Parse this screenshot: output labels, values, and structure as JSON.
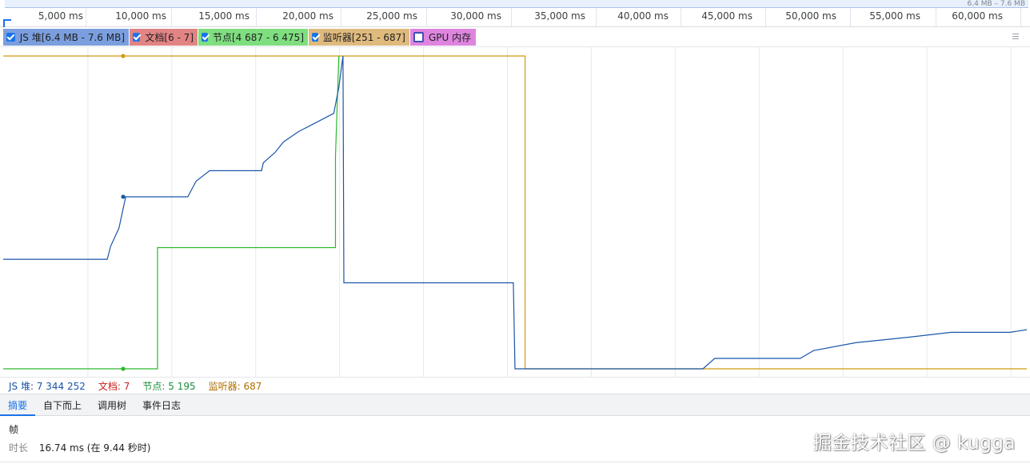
{
  "ruler": {
    "overview_label": "6.4 MB – 7.6 MB",
    "ticks": [
      "5,000 ms",
      "10,000 ms",
      "15,000 ms",
      "20,000 ms",
      "25,000 ms",
      "30,000 ms",
      "35,000 ms",
      "40,000 ms",
      "45,000 ms",
      "50,000 ms",
      "55,000 ms",
      "60,000 ms"
    ]
  },
  "legend": {
    "items": [
      {
        "label": "JS 堆[6.4 MB - 7.6 MB]",
        "checked": true,
        "bg": "#7b9fde"
      },
      {
        "label": "文档[6 - 7]",
        "checked": true,
        "bg": "#e28484"
      },
      {
        "label": "节点[4 687 - 6 475]",
        "checked": true,
        "bg": "#7fde7f"
      },
      {
        "label": "监听器[251 - 687]",
        "checked": true,
        "bg": "#dfba7d"
      },
      {
        "label": "GPU 内存",
        "checked": false,
        "bg": "#df85df"
      }
    ]
  },
  "chart_data": {
    "type": "line",
    "x_unit": "ms",
    "xlim": [
      0,
      61000
    ],
    "series": [
      {
        "name": "JS 堆",
        "color": "#1a56a8",
        "range": [
          6.4,
          7.6
        ],
        "unit": "MB",
        "points": [
          [
            0,
            6.82
          ],
          [
            6200,
            6.82
          ],
          [
            6400,
            6.87
          ],
          [
            6900,
            6.94
          ],
          [
            7100,
            7.0
          ],
          [
            7300,
            7.06
          ],
          [
            11000,
            7.06
          ],
          [
            11500,
            7.12
          ],
          [
            12300,
            7.16
          ],
          [
            15400,
            7.16
          ],
          [
            15500,
            7.19
          ],
          [
            16200,
            7.23
          ],
          [
            16700,
            7.27
          ],
          [
            17600,
            7.31
          ],
          [
            19700,
            7.38
          ],
          [
            20000,
            7.48
          ],
          [
            20250,
            7.6
          ],
          [
            20300,
            6.73
          ],
          [
            30400,
            6.73
          ],
          [
            30500,
            6.4
          ],
          [
            41700,
            6.4
          ],
          [
            42400,
            6.44
          ],
          [
            47500,
            6.44
          ],
          [
            48300,
            6.47
          ],
          [
            50800,
            6.5
          ],
          [
            53800,
            6.52
          ],
          [
            56500,
            6.54
          ],
          [
            60000,
            6.54
          ],
          [
            61000,
            6.55
          ]
        ]
      },
      {
        "name": "文档",
        "color": "#d93025",
        "range": [
          6,
          7
        ],
        "unit": "",
        "points": [
          [
            0,
            7
          ],
          [
            61000,
            7
          ]
        ]
      },
      {
        "name": "节点",
        "color": "#2db82d",
        "range": [
          4687,
          6475
        ],
        "unit": "",
        "points": [
          [
            0,
            4687
          ],
          [
            9200,
            4687
          ],
          [
            9200,
            5380
          ],
          [
            19800,
            5380
          ],
          [
            19800,
            5900
          ],
          [
            20000,
            6475
          ]
        ]
      },
      {
        "name": "监听器",
        "color": "#d19a12",
        "range": [
          251,
          687
        ],
        "unit": "",
        "points": [
          [
            0,
            687
          ],
          [
            31100,
            687
          ],
          [
            31100,
            251
          ],
          [
            61000,
            251
          ]
        ]
      }
    ],
    "markers": [
      {
        "series": "JS 堆",
        "x": 7150,
        "y": 7.06
      },
      {
        "series": "节点",
        "x": 7150,
        "y": 4687
      },
      {
        "series": "监听器",
        "x": 7150,
        "y": 687
      }
    ],
    "grid": true
  },
  "counters": {
    "js_heap": "JS 堆: 7 344 252",
    "documents": "文档: 7",
    "nodes": "节点: 5 195",
    "listeners": "监听器: 687"
  },
  "tabs": [
    {
      "label": "摘要",
      "active": true
    },
    {
      "label": "自下而上",
      "active": false
    },
    {
      "label": "调用树",
      "active": false
    },
    {
      "label": "事件日志",
      "active": false
    }
  ],
  "summary": {
    "heading": "帧",
    "duration_label": "时长",
    "duration_value": "16.74 ms (在 9.44 秒时)"
  },
  "watermark": "掘金技术社区 @ kugga"
}
